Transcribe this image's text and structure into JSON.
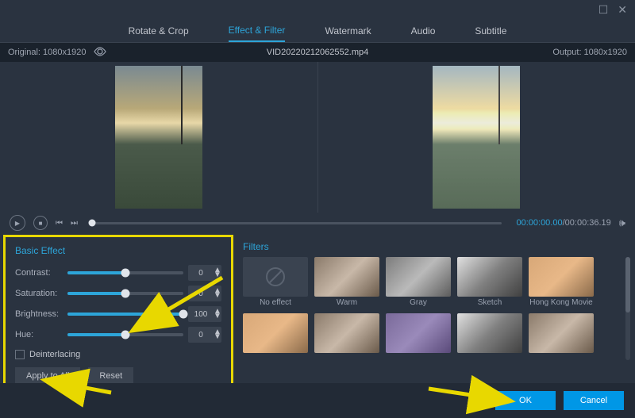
{
  "window": {
    "maximize_icon": "☐",
    "close_icon": "✕"
  },
  "tabs": [
    {
      "label": "Rotate & Crop"
    },
    {
      "label": "Effect & Filter"
    },
    {
      "label": "Watermark"
    },
    {
      "label": "Audio"
    },
    {
      "label": "Subtitle"
    }
  ],
  "filebar": {
    "original": "Original: 1080x1920",
    "filename": "VID20220212062552.mp4",
    "output": "Output: 1080x1920"
  },
  "playback": {
    "current": "00:00:00.00",
    "duration": "00:00:36.19"
  },
  "basic_effect": {
    "title": "Basic Effect",
    "contrast": {
      "label": "Contrast:",
      "value": "0",
      "percent": 50
    },
    "saturation": {
      "label": "Saturation:",
      "value": "0",
      "percent": 50
    },
    "brightness": {
      "label": "Brightness:",
      "value": "100",
      "percent": 100
    },
    "hue": {
      "label": "Hue:",
      "value": "0",
      "percent": 50
    },
    "deinterlacing": "Deinterlacing",
    "apply_all": "Apply to All",
    "reset": "Reset"
  },
  "filters": {
    "title": "Filters",
    "row1": [
      {
        "label": "No effect"
      },
      {
        "label": "Warm"
      },
      {
        "label": "Gray"
      },
      {
        "label": "Sketch"
      },
      {
        "label": "Hong Kong Movie"
      }
    ],
    "row2": [
      {
        "label": ""
      },
      {
        "label": ""
      },
      {
        "label": ""
      },
      {
        "label": ""
      },
      {
        "label": ""
      }
    ]
  },
  "footer": {
    "ok": "OK",
    "cancel": "Cancel"
  }
}
